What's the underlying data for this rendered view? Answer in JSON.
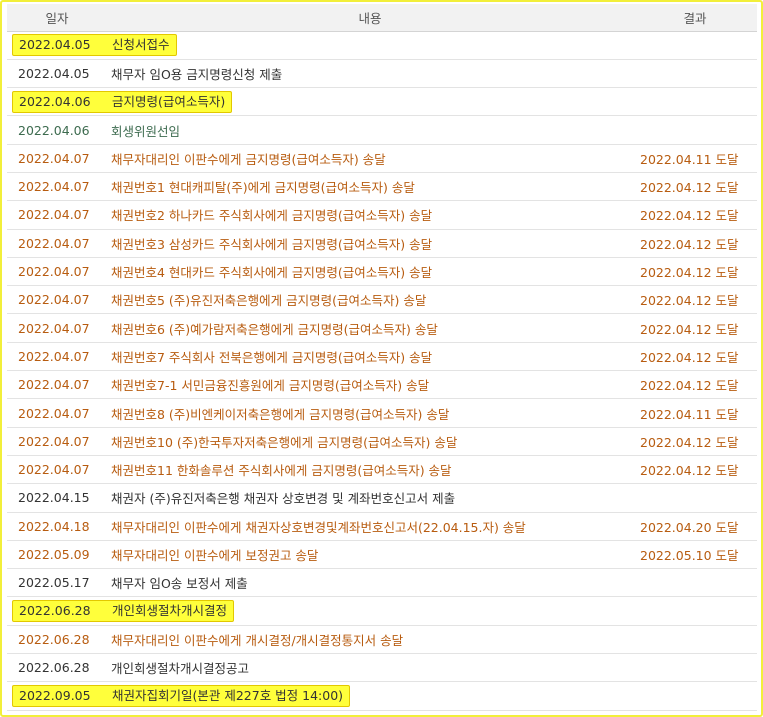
{
  "headers": {
    "date": "일자",
    "content": "내용",
    "result": "결과"
  },
  "colors": {
    "highlight": "#ffff3b",
    "frame": "#f2ef3a",
    "delivered_text": "#b85c10",
    "normal_text": "#333333",
    "green_text": "#3d6b4f"
  },
  "rows": [
    {
      "date": "2022.04.05",
      "content": "신청서접수",
      "result": "",
      "style": "highlight"
    },
    {
      "date": "2022.04.05",
      "content": "채무자 임O용 금지명령신청 제출",
      "result": "",
      "style": "normal"
    },
    {
      "date": "2022.04.06",
      "content": "금지명령(급여소득자)",
      "result": "",
      "style": "highlight"
    },
    {
      "date": "2022.04.06",
      "content": "회생위원선임",
      "result": "",
      "style": "green"
    },
    {
      "date": "2022.04.07",
      "content": "채무자대리인 이판수에게 금지명령(급여소득자) 송달",
      "result": "2022.04.11 도달",
      "style": "orange"
    },
    {
      "date": "2022.04.07",
      "content": "채권번호1 현대캐피탈(주)에게 금지명령(급여소득자) 송달",
      "result": "2022.04.12 도달",
      "style": "orange"
    },
    {
      "date": "2022.04.07",
      "content": "채권번호2 하나카드 주식회사에게 금지명령(급여소득자) 송달",
      "result": "2022.04.12 도달",
      "style": "orange"
    },
    {
      "date": "2022.04.07",
      "content": "채권번호3 삼성카드 주식회사에게 금지명령(급여소득자) 송달",
      "result": "2022.04.12 도달",
      "style": "orange"
    },
    {
      "date": "2022.04.07",
      "content": "채권번호4 현대카드 주식회사에게 금지명령(급여소득자) 송달",
      "result": "2022.04.12 도달",
      "style": "orange"
    },
    {
      "date": "2022.04.07",
      "content": "채권번호5 (주)유진저축은행에게 금지명령(급여소득자) 송달",
      "result": "2022.04.12 도달",
      "style": "orange"
    },
    {
      "date": "2022.04.07",
      "content": "채권번호6 (주)예가람저축은행에게 금지명령(급여소득자) 송달",
      "result": "2022.04.12 도달",
      "style": "orange"
    },
    {
      "date": "2022.04.07",
      "content": "채권번호7 주식회사 전북은행에게 금지명령(급여소득자) 송달",
      "result": "2022.04.12 도달",
      "style": "orange"
    },
    {
      "date": "2022.04.07",
      "content": "채권번호7-1 서민금융진흥원에게 금지명령(급여소득자) 송달",
      "result": "2022.04.12 도달",
      "style": "orange"
    },
    {
      "date": "2022.04.07",
      "content": "채권번호8 (주)비엔케이저축은행에게 금지명령(급여소득자) 송달",
      "result": "2022.04.11 도달",
      "style": "orange"
    },
    {
      "date": "2022.04.07",
      "content": "채권번호10 (주)한국투자저축은행에게 금지명령(급여소득자) 송달",
      "result": "2022.04.12 도달",
      "style": "orange"
    },
    {
      "date": "2022.04.07",
      "content": "채권번호11 한화솔루션 주식회사에게 금지명령(급여소득자) 송달",
      "result": "2022.04.12 도달",
      "style": "orange"
    },
    {
      "date": "2022.04.15",
      "content": "채권자 (주)유진저축은행 채권자 상호변경 및 계좌번호신고서 제출",
      "result": "",
      "style": "normal"
    },
    {
      "date": "2022.04.18",
      "content": "채무자대리인 이판수에게 채권자상호변경및계좌번호신고서(22.04.15.자) 송달",
      "result": "2022.04.20 도달",
      "style": "orange"
    },
    {
      "date": "2022.05.09",
      "content": "채무자대리인 이판수에게 보정권고 송달",
      "result": "2022.05.10 도달",
      "style": "orange"
    },
    {
      "date": "2022.05.17",
      "content": "채무자 임O송 보정서 제출",
      "result": "",
      "style": "normal"
    },
    {
      "date": "2022.06.28",
      "content": "개인회생절차개시결정",
      "result": "",
      "style": "highlight"
    },
    {
      "date": "2022.06.28",
      "content": "채무자대리인 이판수에게 개시결정/개시결정통지서 송달",
      "result": "",
      "style": "orange"
    },
    {
      "date": "2022.06.28",
      "content": "개인회생절차개시결정공고",
      "result": "",
      "style": "normal"
    },
    {
      "date": "2022.09.05",
      "content": "채권자집회기일(본관 제227호 법정 14:00)",
      "result": "",
      "style": "highlight"
    }
  ]
}
